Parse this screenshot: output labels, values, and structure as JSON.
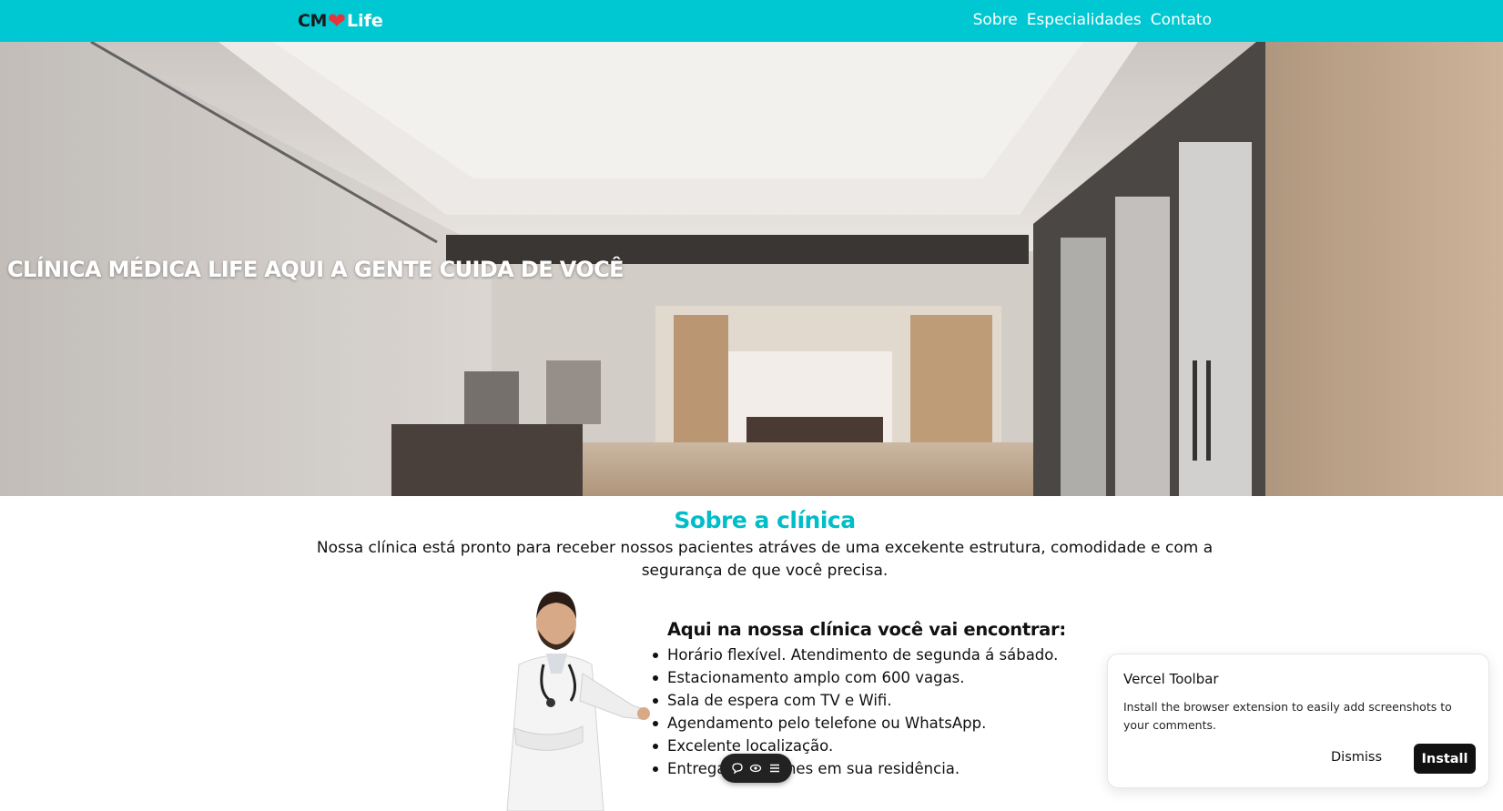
{
  "header": {
    "logo": {
      "cm": "CM",
      "heart_icon": "heart-icon",
      "life": "Life"
    },
    "nav": [
      "Sobre",
      "Especialidades",
      "Contato"
    ],
    "color": "#00c8d2"
  },
  "hero": {
    "title": "CLÍNICA MÉDICA LIFE AQUI A GENTE CUIDA DE VOCÊ"
  },
  "about": {
    "title": "Sobre a clínica",
    "text": "Nossa clínica está pronto para receber nossos pacientes atráves de uma excekente estrutura, comodidade e com a segurança de que você precisa.",
    "features_title": "Aqui na nossa clínica você vai encontrar:",
    "features": [
      "Horário flexível. Atendimento de segunda á sábado.",
      "Estacionamento amplo com 600 vagas.",
      "Sala de espera com TV e Wifi.",
      "Agendamento pelo telefone ou WhatsApp.",
      "Excelente localização.",
      "Entrega de exames em sua residência."
    ],
    "accent_color": "#00bdc8"
  },
  "toolbar_pill": {
    "icons": [
      "comment-icon",
      "eye-icon",
      "menu-icon"
    ]
  },
  "toast": {
    "title": "Vercel Toolbar",
    "body": "Install the browser extension to easily add screenshots to your comments.",
    "dismiss_label": "Dismiss",
    "install_label": "Install"
  }
}
